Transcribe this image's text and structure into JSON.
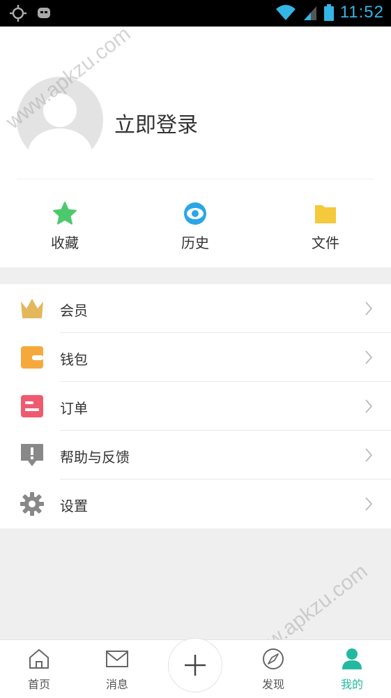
{
  "status_bar": {
    "time": "11:52",
    "icons": [
      "gps-icon",
      "notification-icon",
      "wifi-icon",
      "signal-icon",
      "battery-icon"
    ],
    "accent": "#33b5e5"
  },
  "profile": {
    "login_label": "立即登录",
    "avatar_icon": "default-avatar-icon"
  },
  "shortcuts": [
    {
      "label": "收藏",
      "icon": "star-icon",
      "color": "#4cc96d"
    },
    {
      "label": "历史",
      "icon": "eye-icon",
      "color": "#2aa6e6"
    },
    {
      "label": "文件",
      "icon": "folder-icon",
      "color": "#f5c93c"
    }
  ],
  "menu": [
    {
      "label": "会员",
      "icon": "crown-icon",
      "color": "#e3b85d"
    },
    {
      "label": "钱包",
      "icon": "wallet-icon",
      "color": "#f5a93c"
    },
    {
      "label": "订单",
      "icon": "order-icon",
      "color": "#f05a6e"
    },
    {
      "label": "帮助与反馈",
      "icon": "feedback-icon",
      "color": "#888888"
    },
    {
      "label": "设置",
      "icon": "gear-icon",
      "color": "#888888"
    }
  ],
  "watermark": "www.apkzu.com",
  "bottom_nav": {
    "items": [
      {
        "label": "首页",
        "icon": "home-icon"
      },
      {
        "label": "消息",
        "icon": "mail-icon"
      },
      {
        "label": "发现",
        "icon": "compass-icon"
      },
      {
        "label": "我的",
        "icon": "user-icon"
      }
    ],
    "active_index": 3,
    "active_color": "#22b9a0",
    "add_icon": "plus-icon"
  }
}
